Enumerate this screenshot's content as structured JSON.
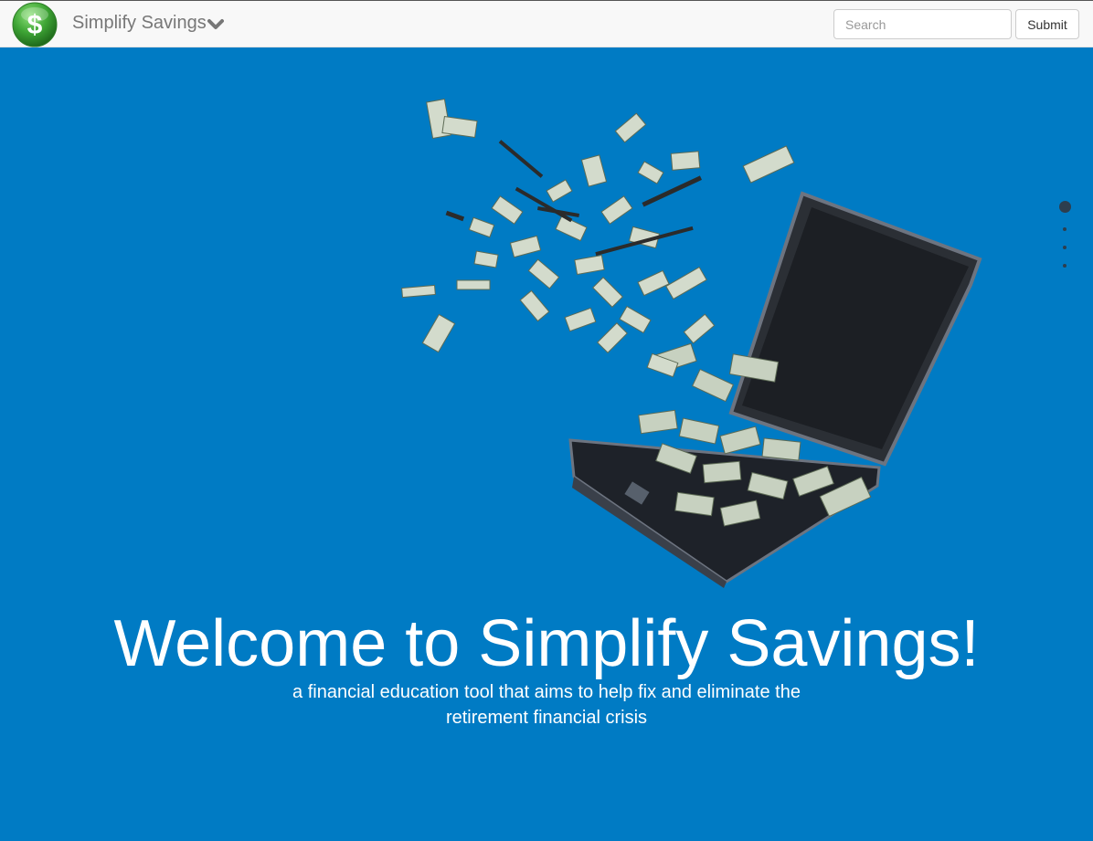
{
  "navbar": {
    "logo_icon": "dollar-coin-icon",
    "brand": "Simplify Savings",
    "dropdown_icon": "chevron-down-icon",
    "search_placeholder": "Search",
    "search_value": "",
    "submit_label": "Submit"
  },
  "hero": {
    "image_icon": "briefcase-money-icon",
    "headline": "Welcome to Simplify Savings!",
    "tagline": "a financial education tool that aims to help fix and eliminate the retirement financial crisis",
    "section_dots": 4,
    "active_dot": 1
  },
  "colors": {
    "hero_bg": "#007bc4",
    "navbar_bg": "#f8f8f8",
    "logo_green": "#3ea535",
    "dot": "#2d3e4e"
  }
}
